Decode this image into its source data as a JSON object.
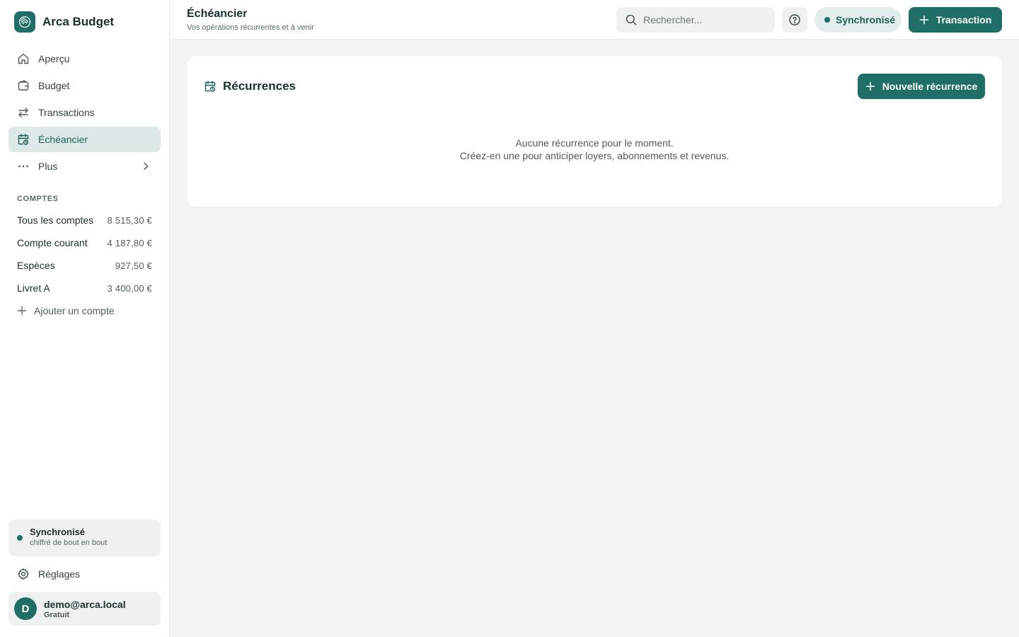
{
  "app": {
    "name": "Arca Budget"
  },
  "nav": {
    "items": [
      {
        "label": "Aperçu",
        "icon": "home-icon"
      },
      {
        "label": "Budget",
        "icon": "wallet-icon"
      },
      {
        "label": "Transactions",
        "icon": "arrows-swap-icon"
      },
      {
        "label": "Échéancier",
        "icon": "calendar-clock-icon",
        "active": true
      },
      {
        "label": "Plus",
        "icon": "more-dots-icon"
      }
    ]
  },
  "accounts": {
    "section_label": "COMPTES",
    "items": [
      {
        "name": "Tous les comptes",
        "amount": "8 515,30 €"
      },
      {
        "name": "Compte courant",
        "amount": "4 187,80 €"
      },
      {
        "name": "Espèces",
        "amount": "927,50 €"
      },
      {
        "name": "Livret A",
        "amount": "3 400,00 €"
      }
    ],
    "add_label": "Ajouter un compte"
  },
  "sync_card": {
    "title": "Synchronisé",
    "subtitle": "chiffré de bout en bout"
  },
  "settings_label": "Réglages",
  "user": {
    "initial": "D",
    "email": "demo@arca.local",
    "plan": "Gratuit"
  },
  "header": {
    "title": "Échéancier",
    "subtitle": "Vos opérations récurrentes et à venir",
    "search_placeholder": "Rechercher...",
    "sync_status": "Synchronisé",
    "new_transaction_label": "Transaction"
  },
  "recurrences": {
    "title": "Récurrences",
    "new_button_label": "Nouvelle récurrence",
    "empty_line1": "Aucune récurrence pour le moment.",
    "empty_line2": "Créez-en une pour anticiper loyers, abonnements et revenus."
  },
  "colors": {
    "accent": "#1f6e67",
    "active_bg": "#dde9e7",
    "page_bg": "#f3f5f4"
  }
}
